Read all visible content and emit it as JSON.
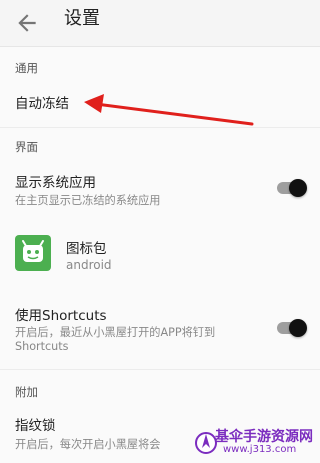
{
  "appbar": {
    "title": "设置"
  },
  "sections": {
    "general": "通用",
    "interface": "界面",
    "extra": "附加"
  },
  "items": {
    "auto_freeze": {
      "title": "自动冻结"
    },
    "show_system_apps": {
      "title": "显示系统应用",
      "subtitle": "在主页显示已冻结的系统应用",
      "enabled": true
    },
    "icon_pack": {
      "title": "图标包",
      "subtitle": "android"
    },
    "shortcuts": {
      "title": "使用Shortcuts",
      "subtitle_line1": "开启后，最近从小黑屋打开的APP将钉到",
      "subtitle_line2": "Shortcuts",
      "enabled": true
    },
    "fingerprint": {
      "title": "指纹锁",
      "subtitle": "开启后，每次开启小黑屋将会"
    }
  },
  "watermark": {
    "name": "基伞手游资源网",
    "url": "www.j313.com"
  },
  "colors": {
    "annotation_arrow": "#e0201c",
    "icon_pack_bg": "#4caf50"
  }
}
